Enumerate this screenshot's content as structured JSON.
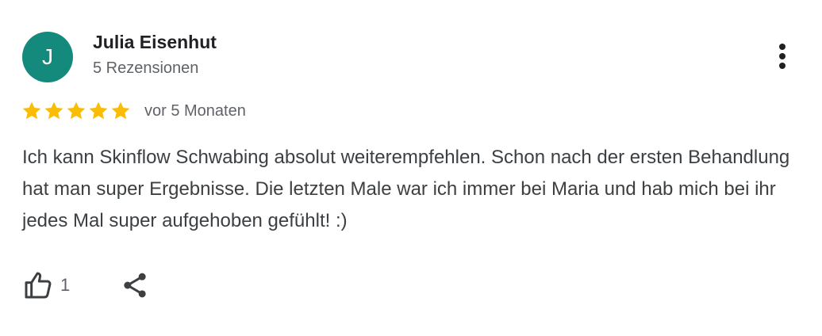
{
  "reviewer": {
    "initial": "J",
    "name": "Julia Eisenhut",
    "review_count": "5 Rezensionen",
    "avatar_color": "#148a7c"
  },
  "review": {
    "rating": 5,
    "rating_max": 5,
    "star_color": "#fbbc04",
    "date": "vor 5 Monaten",
    "text": "Ich kann Skinflow Schwabing absolut weiterempfehlen. Schon nach der ersten Behandlung hat man super Ergebnisse. Die letzten Male war ich immer bei Maria und hab mich bei ihr jedes Mal super aufgehoben gefühlt! :)"
  },
  "actions": {
    "like_count": "1",
    "icons": [
      "thumbs-up-icon",
      "share-icon",
      "more-vert-icon"
    ]
  }
}
